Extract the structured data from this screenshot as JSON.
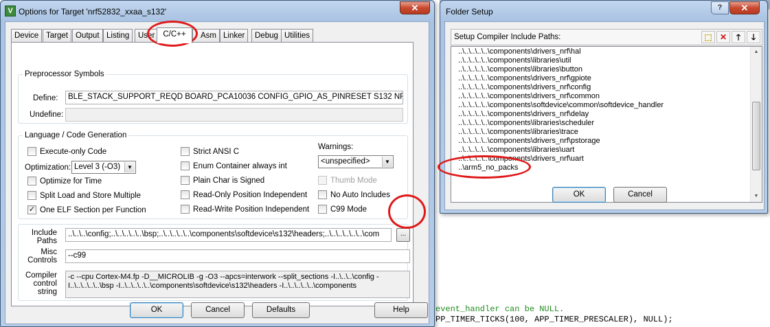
{
  "background": {
    "code_lines": [
      "event_handler can be NULL.",
      "PP_TIMER_TICKS(100, APP_TIMER_PRESCALER), NULL);"
    ]
  },
  "options_dialog": {
    "title": "Options for Target 'nrf52832_xxaa_s132'",
    "icon_letter": "V",
    "close_glyph": "✕",
    "tabs": [
      "Device",
      "Target",
      "Output",
      "Listing",
      "User",
      "C/C++",
      "Asm",
      "Linker",
      "Debug",
      "Utilities"
    ],
    "active_tab": "C/C++",
    "preprocessor": {
      "legend": "Preprocessor Symbols",
      "define_label": "Define:",
      "define_value": "BLE_STACK_SUPPORT_REQD BOARD_PCA10036 CONFIG_GPIO_AS_PINRESET S132 NRF52 SOFTDEVICE_PRESENT",
      "undefine_label": "Undefine:",
      "undefine_value": ""
    },
    "language": {
      "legend": "Language / Code Generation",
      "execute_only": {
        "label": "Execute-only Code",
        "checked": false
      },
      "optimization_label": "Optimization:",
      "optimization_value": "Level 3 (-O3)",
      "optimize_time": {
        "label": "Optimize for Time",
        "checked": false
      },
      "split_load": {
        "label": "Split Load and Store Multiple",
        "checked": false
      },
      "one_elf": {
        "label": "One ELF Section per Function",
        "checked": true
      },
      "strict_ansi": {
        "label": "Strict ANSI C",
        "checked": false
      },
      "enum_container": {
        "label": "Enum Container always int",
        "checked": false
      },
      "plain_char": {
        "label": "Plain Char is Signed",
        "checked": false
      },
      "ro_pi": {
        "label": "Read-Only Position Independent",
        "checked": false
      },
      "rw_pi": {
        "label": "Read-Write Position Independent",
        "checked": false
      },
      "warnings_label": "Warnings:",
      "warnings_value": "<unspecified>",
      "thumb_mode": {
        "label": "Thumb Mode",
        "checked": false,
        "disabled": true
      },
      "no_auto_includes": {
        "label": "No Auto Includes",
        "checked": false
      },
      "c99_mode": {
        "label": "C99 Mode",
        "checked": false
      }
    },
    "include_paths": {
      "label": "Include\nPaths",
      "value": "..\\..\\..\\config;..\\..\\..\\..\\..\\bsp;..\\..\\..\\..\\..\\components\\softdevice\\s132\\headers;..\\..\\..\\..\\..\\..\\com",
      "browse_label": "..."
    },
    "misc_controls": {
      "label": "Misc\nControls",
      "value": "--c99"
    },
    "compiler_string": {
      "label": "Compiler\ncontrol\nstring",
      "value": "-c --cpu Cortex-M4.fp -D__MICROLIB -g -O3 --apcs=interwork --split_sections -I..\\..\\..\\config -I..\\..\\..\\..\\..\\bsp -I..\\..\\..\\..\\..\\components\\softdevice\\s132\\headers -I..\\..\\..\\..\\..\\components"
    },
    "buttons": {
      "ok": "OK",
      "cancel": "Cancel",
      "defaults": "Defaults",
      "help": "Help"
    }
  },
  "folder_setup": {
    "title": "Folder Setup",
    "help_glyph": "?",
    "close_glyph": "✕",
    "header_label": "Setup Compiler Include Paths:",
    "toolbar_icons": [
      "new-icon",
      "delete-icon",
      "move-up-icon",
      "move-down-icon"
    ],
    "paths": [
      "..\\..\\..\\..\\..\\components\\drivers_nrf\\hal",
      "..\\..\\..\\..\\..\\components\\libraries\\util",
      "..\\..\\..\\..\\..\\components\\libraries\\button",
      "..\\..\\..\\..\\..\\components\\drivers_nrf\\gpiote",
      "..\\..\\..\\..\\..\\components\\drivers_nrf\\config",
      "..\\..\\..\\..\\..\\components\\drivers_nrf\\common",
      "..\\..\\..\\..\\..\\components\\softdevice\\common\\softdevice_handler",
      "..\\..\\..\\..\\..\\components\\drivers_nrf\\delay",
      "..\\..\\..\\..\\..\\components\\libraries\\scheduler",
      "..\\..\\..\\..\\..\\components\\libraries\\trace",
      "..\\..\\..\\..\\..\\components\\drivers_nrf\\pstorage",
      "..\\..\\..\\..\\..\\components\\libraries\\uart",
      "..\\..\\..\\..\\..\\components\\drivers_nrf\\uart",
      "..\\arm5_no_packs"
    ],
    "buttons": {
      "ok": "OK",
      "cancel": "Cancel"
    }
  },
  "colors": {
    "annotation": "#e01818",
    "title_bar": "#b7cde8",
    "dialog_bg": "#f0f0f0"
  }
}
